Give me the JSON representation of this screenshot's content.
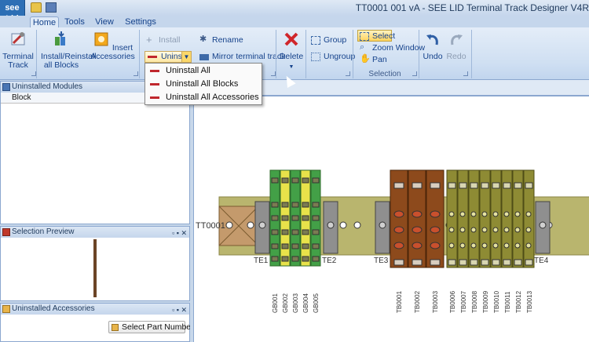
{
  "app": {
    "logo": "see Lid",
    "title": "TT0001 001 vA - SEE LID Terminal Track Designer V4R"
  },
  "tabs": [
    "Home",
    "Tools",
    "View",
    "Settings"
  ],
  "ribbon": {
    "terminal_track": "Terminal Track",
    "install_reinstall": "Install/Reinstall all Blocks",
    "insert_accessories": "Insert Accessories",
    "install": "Install",
    "uninstall_short": "Uninsta",
    "rename": "Rename",
    "mirror": "Mirror terminal track",
    "delete": "Delete",
    "group": "Group",
    "ungroup": "Ungroup",
    "select": "Select",
    "zoom_window": "Zoom Window",
    "pan": "Pan",
    "selection_group": "Selection",
    "undo": "Undo",
    "redo": "Redo"
  },
  "dropdown": [
    "Uninstall All",
    "Uninstall All Blocks",
    "Uninstall All Accessories"
  ],
  "panels": {
    "uninstalled_modules": "Uninstalled Modules",
    "block_col": "Block",
    "selection_preview": "Selection Preview",
    "uninstalled_accessories": "Uninstalled Accessories",
    "select_part": "Select Part Number"
  },
  "canvas": {
    "track_label": "TT0001",
    "end_labels": [
      "TE1",
      "TE2",
      "TE3",
      "TE4"
    ],
    "green_blocks": [
      "GB001",
      "GB002",
      "GB003",
      "GB004",
      "GB005"
    ],
    "brown_blocks": [
      "TB0001",
      "TB0002",
      "TB0003"
    ],
    "olive_blocks": [
      "TB0006",
      "TB0007",
      "TB0008",
      "TB0009",
      "TB0010",
      "TB0011",
      "TB0012",
      "TB0013"
    ],
    "colors": {
      "rail": "#b9b56e",
      "green": "#43a047",
      "yellow": "#e8e24a",
      "brown": "#8d4a1c",
      "olive": "#8e8b34",
      "end": "#8f8f8f"
    }
  }
}
